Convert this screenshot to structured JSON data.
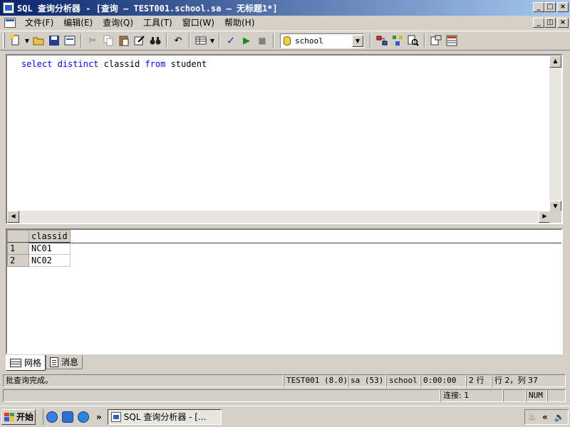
{
  "window": {
    "title": "SQL 查询分析器 - [查询 — TEST001.school.sa — 无标题1*]",
    "min_label": "_",
    "max_label": "□",
    "close_label": "×",
    "mdi_restore_label": "◫"
  },
  "menu": {
    "items": [
      "文件(F)",
      "编辑(E)",
      "查询(Q)",
      "工具(T)",
      "窗口(W)",
      "帮助(H)"
    ]
  },
  "toolbar": {
    "database": "school"
  },
  "editor": {
    "kw1": "select",
    "kw2": "distinct",
    "ident1": "classid",
    "kw3": "from",
    "ident2": "student"
  },
  "results": {
    "columns": [
      "classid"
    ],
    "rows": [
      {
        "num": "1",
        "classid": "NC01"
      },
      {
        "num": "2",
        "classid": "NC02"
      }
    ]
  },
  "tabs": [
    {
      "label": "网格"
    },
    {
      "label": "消息"
    }
  ],
  "status": {
    "message": "批查询完成。",
    "server": "TEST001 (8.0)",
    "user": "sa (53)",
    "db": "school",
    "elapsed": "0:00:00",
    "rows": "2 行",
    "position": "行 2，列 37",
    "connections": "连接: 1",
    "num": "NUM"
  },
  "taskbar": {
    "start_label": "开始",
    "task_label": "SQL 查询分析器 - [...",
    "chevron": "»",
    "tray_chevron": "«"
  }
}
